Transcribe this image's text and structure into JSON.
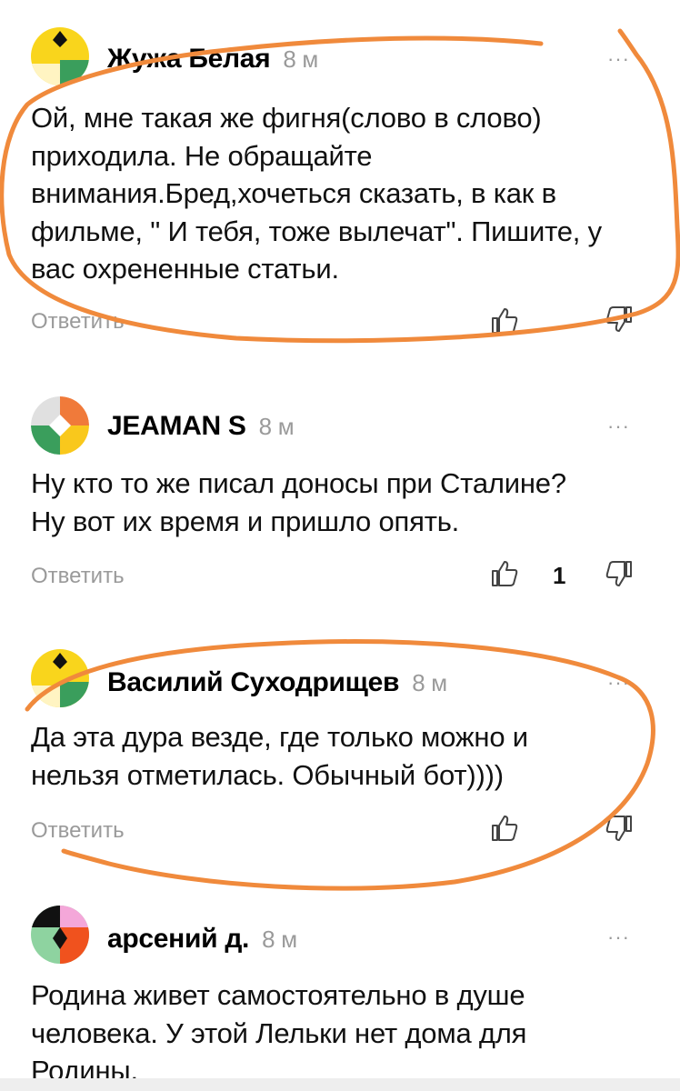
{
  "comments": [
    {
      "author": "Жужа Белая",
      "time": "8 м",
      "more": "···",
      "lines": [
        "Ой, мне такая же фигня(слово в слово)",
        "приходила. Не обращайте",
        "внимания.Бред,хочеться сказать, в как в",
        "фильме, \" И тебя, тоже вылечат\". Пишите, у",
        "вас охрененные статьи."
      ],
      "reply": "Ответить",
      "likes": ""
    },
    {
      "author": "JEAMAN S",
      "time": "8 м",
      "more": "···",
      "lines": [
        "Ну кто то же писал доносы при Сталине?",
        "Ну вот их время и пришло опять."
      ],
      "reply": "Ответить",
      "likes": "1"
    },
    {
      "author": "Василий Суходрищев",
      "time": "8 м",
      "more": "···",
      "lines": [
        "Да эта дура везде, где только можно и",
        "нельзя отметилась. Обычный бот))))"
      ],
      "reply": "Ответить",
      "likes": ""
    },
    {
      "author": "арсений д.",
      "time": "8 м",
      "more": "···",
      "lines": [
        "Родина живет самостоятельно в душе",
        "человека. У этой Лельки нет дома для",
        "Родины."
      ],
      "reply": "",
      "likes": ""
    }
  ],
  "icons": {
    "like": "thumbs-up-icon",
    "dislike": "thumbs-down-icon",
    "more": "more-options-icon"
  },
  "colors": {
    "annotation": "#F08A3C",
    "muted": "#9A9A9A",
    "text": "#111111"
  }
}
